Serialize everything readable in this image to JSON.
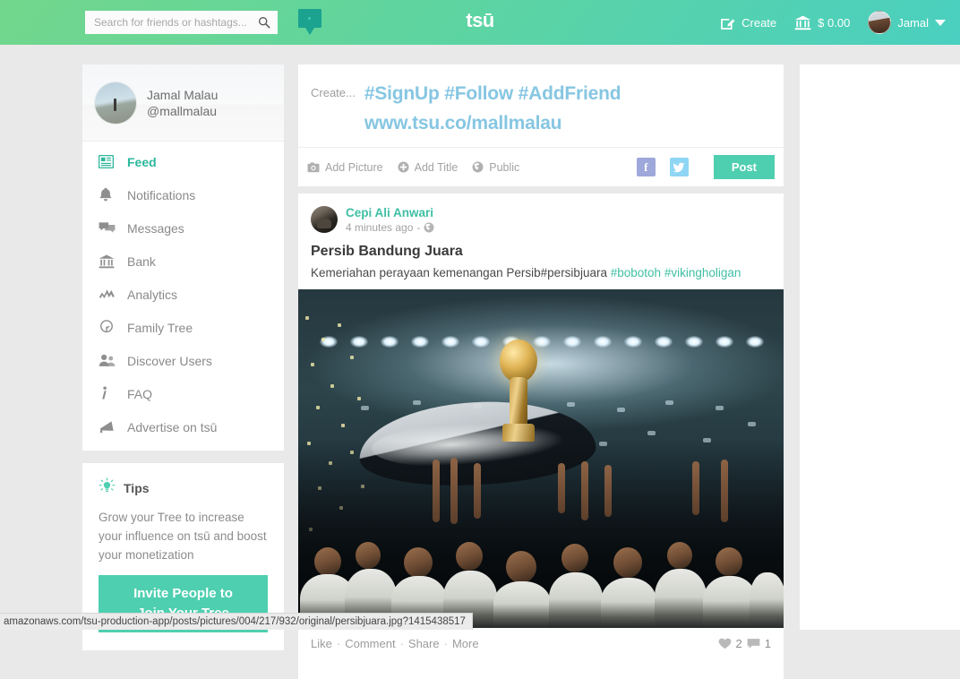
{
  "header": {
    "search_placeholder": "Search for friends or hashtags...",
    "search_value": "",
    "brand": "tsū",
    "create_label": "Create",
    "balance_label": "$ 0.00",
    "user_label": "Jamal"
  },
  "sidebar": {
    "profile": {
      "name": "Jamal Malau",
      "handle": "@mallmalau"
    },
    "items": [
      {
        "label": "Feed",
        "icon": "feed-icon",
        "active": true
      },
      {
        "label": "Notifications",
        "icon": "bell-icon",
        "active": false
      },
      {
        "label": "Messages",
        "icon": "messages-icon",
        "active": false
      },
      {
        "label": "Bank",
        "icon": "bank-icon",
        "active": false
      },
      {
        "label": "Analytics",
        "icon": "analytics-icon",
        "active": false
      },
      {
        "label": "Family Tree",
        "icon": "tree-icon",
        "active": false
      },
      {
        "label": "Discover Users",
        "icon": "users-icon",
        "active": false
      },
      {
        "label": "FAQ",
        "icon": "info-icon",
        "active": false
      },
      {
        "label": "Advertise on tsū",
        "icon": "megaphone-icon",
        "active": false
      }
    ],
    "tips": {
      "title": "Tips",
      "text": "Grow your Tree to increase your influence on tsū and boost your monetization",
      "button_line1": "Invite People to",
      "button_line2": "Join Your Tree"
    }
  },
  "composer": {
    "label": "Create...",
    "text_line1": "#SignUp #Follow #AddFriend",
    "text_line2": "www.tsu.co/mallmalau",
    "add_picture": "Add Picture",
    "add_title": "Add Title",
    "privacy": "Public",
    "facebook_label": "f",
    "twitter_label": "t",
    "post_button": "Post"
  },
  "post": {
    "author": "Cepi Ali Anwari",
    "time": "4 minutes ago",
    "time_separator": "-",
    "title": "Persib Bandung Juara",
    "body_text": "Kemeriahan perayaan kemenangan Persib#persibjuara",
    "tag1": "#bobotoh",
    "tag2": "#vikingholigan",
    "image_alt": "Persib Bandung players celebrating with trophy in stadium",
    "actions": {
      "like": "Like",
      "comment": "Comment",
      "share": "Share",
      "more": "More",
      "separator": "·"
    },
    "like_count": "2",
    "comment_count": "1"
  },
  "status_bar": {
    "url": "amazonaws.com/tsu-production-app/posts/pictures/004/217/932/original/persibjuara.jpg?1415438517"
  },
  "colors": {
    "accent_teal": "#4ecfb0",
    "header_green": "#72d78c",
    "header_teal": "#4acfc0",
    "link_teal": "#3fbfa4",
    "composer_blue": "#86c6e2"
  }
}
